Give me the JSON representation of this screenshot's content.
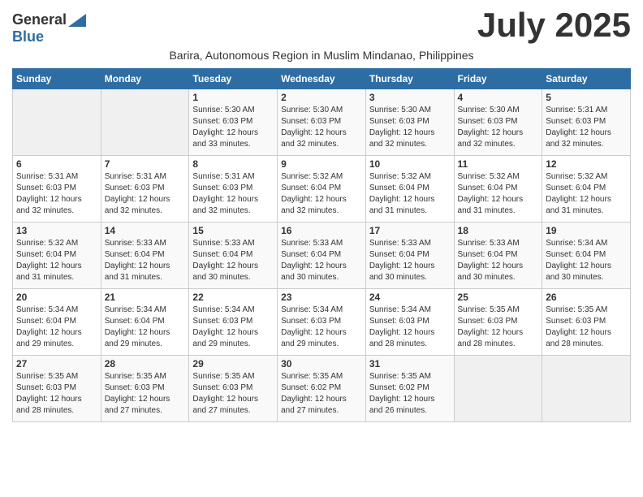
{
  "header": {
    "logo_general": "General",
    "logo_blue": "Blue",
    "month_title": "July 2025",
    "subtitle": "Barira, Autonomous Region in Muslim Mindanao, Philippines"
  },
  "days_of_week": [
    "Sunday",
    "Monday",
    "Tuesday",
    "Wednesday",
    "Thursday",
    "Friday",
    "Saturday"
  ],
  "weeks": [
    [
      {
        "day": "",
        "info": ""
      },
      {
        "day": "",
        "info": ""
      },
      {
        "day": "1",
        "info": "Sunrise: 5:30 AM\nSunset: 6:03 PM\nDaylight: 12 hours\nand 33 minutes."
      },
      {
        "day": "2",
        "info": "Sunrise: 5:30 AM\nSunset: 6:03 PM\nDaylight: 12 hours\nand 32 minutes."
      },
      {
        "day": "3",
        "info": "Sunrise: 5:30 AM\nSunset: 6:03 PM\nDaylight: 12 hours\nand 32 minutes."
      },
      {
        "day": "4",
        "info": "Sunrise: 5:30 AM\nSunset: 6:03 PM\nDaylight: 12 hours\nand 32 minutes."
      },
      {
        "day": "5",
        "info": "Sunrise: 5:31 AM\nSunset: 6:03 PM\nDaylight: 12 hours\nand 32 minutes."
      }
    ],
    [
      {
        "day": "6",
        "info": "Sunrise: 5:31 AM\nSunset: 6:03 PM\nDaylight: 12 hours\nand 32 minutes."
      },
      {
        "day": "7",
        "info": "Sunrise: 5:31 AM\nSunset: 6:03 PM\nDaylight: 12 hours\nand 32 minutes."
      },
      {
        "day": "8",
        "info": "Sunrise: 5:31 AM\nSunset: 6:03 PM\nDaylight: 12 hours\nand 32 minutes."
      },
      {
        "day": "9",
        "info": "Sunrise: 5:32 AM\nSunset: 6:04 PM\nDaylight: 12 hours\nand 32 minutes."
      },
      {
        "day": "10",
        "info": "Sunrise: 5:32 AM\nSunset: 6:04 PM\nDaylight: 12 hours\nand 31 minutes."
      },
      {
        "day": "11",
        "info": "Sunrise: 5:32 AM\nSunset: 6:04 PM\nDaylight: 12 hours\nand 31 minutes."
      },
      {
        "day": "12",
        "info": "Sunrise: 5:32 AM\nSunset: 6:04 PM\nDaylight: 12 hours\nand 31 minutes."
      }
    ],
    [
      {
        "day": "13",
        "info": "Sunrise: 5:32 AM\nSunset: 6:04 PM\nDaylight: 12 hours\nand 31 minutes."
      },
      {
        "day": "14",
        "info": "Sunrise: 5:33 AM\nSunset: 6:04 PM\nDaylight: 12 hours\nand 31 minutes."
      },
      {
        "day": "15",
        "info": "Sunrise: 5:33 AM\nSunset: 6:04 PM\nDaylight: 12 hours\nand 30 minutes."
      },
      {
        "day": "16",
        "info": "Sunrise: 5:33 AM\nSunset: 6:04 PM\nDaylight: 12 hours\nand 30 minutes."
      },
      {
        "day": "17",
        "info": "Sunrise: 5:33 AM\nSunset: 6:04 PM\nDaylight: 12 hours\nand 30 minutes."
      },
      {
        "day": "18",
        "info": "Sunrise: 5:33 AM\nSunset: 6:04 PM\nDaylight: 12 hours\nand 30 minutes."
      },
      {
        "day": "19",
        "info": "Sunrise: 5:34 AM\nSunset: 6:04 PM\nDaylight: 12 hours\nand 30 minutes."
      }
    ],
    [
      {
        "day": "20",
        "info": "Sunrise: 5:34 AM\nSunset: 6:04 PM\nDaylight: 12 hours\nand 29 minutes."
      },
      {
        "day": "21",
        "info": "Sunrise: 5:34 AM\nSunset: 6:04 PM\nDaylight: 12 hours\nand 29 minutes."
      },
      {
        "day": "22",
        "info": "Sunrise: 5:34 AM\nSunset: 6:03 PM\nDaylight: 12 hours\nand 29 minutes."
      },
      {
        "day": "23",
        "info": "Sunrise: 5:34 AM\nSunset: 6:03 PM\nDaylight: 12 hours\nand 29 minutes."
      },
      {
        "day": "24",
        "info": "Sunrise: 5:34 AM\nSunset: 6:03 PM\nDaylight: 12 hours\nand 28 minutes."
      },
      {
        "day": "25",
        "info": "Sunrise: 5:35 AM\nSunset: 6:03 PM\nDaylight: 12 hours\nand 28 minutes."
      },
      {
        "day": "26",
        "info": "Sunrise: 5:35 AM\nSunset: 6:03 PM\nDaylight: 12 hours\nand 28 minutes."
      }
    ],
    [
      {
        "day": "27",
        "info": "Sunrise: 5:35 AM\nSunset: 6:03 PM\nDaylight: 12 hours\nand 28 minutes."
      },
      {
        "day": "28",
        "info": "Sunrise: 5:35 AM\nSunset: 6:03 PM\nDaylight: 12 hours\nand 27 minutes."
      },
      {
        "day": "29",
        "info": "Sunrise: 5:35 AM\nSunset: 6:03 PM\nDaylight: 12 hours\nand 27 minutes."
      },
      {
        "day": "30",
        "info": "Sunrise: 5:35 AM\nSunset: 6:02 PM\nDaylight: 12 hours\nand 27 minutes."
      },
      {
        "day": "31",
        "info": "Sunrise: 5:35 AM\nSunset: 6:02 PM\nDaylight: 12 hours\nand 26 minutes."
      },
      {
        "day": "",
        "info": ""
      },
      {
        "day": "",
        "info": ""
      }
    ]
  ]
}
